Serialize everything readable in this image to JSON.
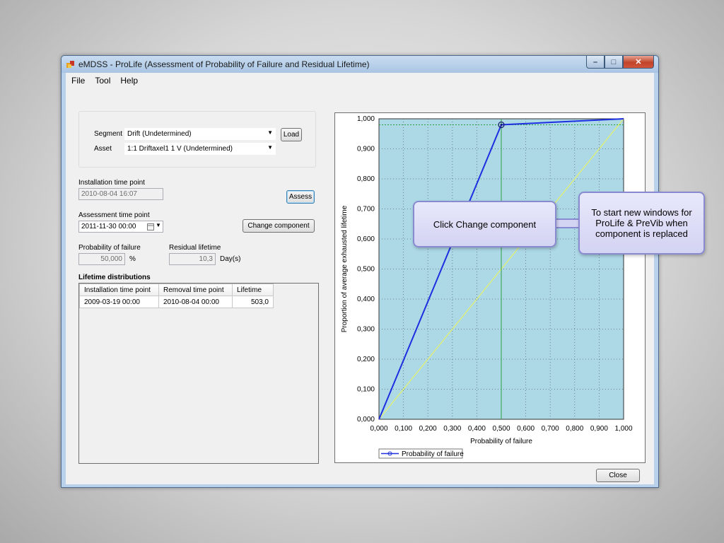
{
  "window": {
    "title": "eMDSS - ProLife (Assessment of Probability of Failure and Residual Lifetime)",
    "min_glyph": "–",
    "max_glyph": "□",
    "close_glyph": "✕"
  },
  "menu": [
    "File",
    "Tool",
    "Help"
  ],
  "segment": {
    "label": "Segment",
    "value": "Drift (Undetermined)"
  },
  "asset": {
    "label": "Asset",
    "value": "1:1    Driftaxel1 1 V (Undetermined)"
  },
  "load_label": "Load",
  "installation": {
    "label": "Installation time point",
    "value": "2010-08-04 16:07"
  },
  "assess_label": "Assess",
  "assessment": {
    "label": "Assessment time point",
    "value": "2011-11-30 00:00"
  },
  "change_component_label": "Change component",
  "probability": {
    "label": "Probability of failure",
    "value": "50,000",
    "unit": "%"
  },
  "residual": {
    "label": "Residual lifetime",
    "value": "10,3",
    "unit": "Day(s)"
  },
  "lifetime_distributions": {
    "title": "Lifetime distributions",
    "columns": [
      "Installation time point",
      "Removal time point",
      "Lifetime"
    ],
    "rows": [
      [
        "2009-03-19 00:00",
        "2010-08-04 00:00",
        "503,0"
      ]
    ]
  },
  "close_label": "Close",
  "callouts": {
    "left": "Click Change component",
    "right": "To start new windows for ProLife & PreVib when component is replaced"
  },
  "colors": {
    "plot_background": "#add8e6",
    "series": "#1d2fe0",
    "diagonal": "#e5f26a",
    "reference": "#2ea043"
  },
  "chart_data": {
    "type": "line",
    "xlabel": "Probability of failure",
    "ylabel": "Proportion of average exhausted lifetime",
    "xlim": [
      0,
      1
    ],
    "ylim": [
      0,
      1
    ],
    "x_ticks": [
      "0,000",
      "0,100",
      "0,200",
      "0,300",
      "0,400",
      "0,500",
      "0,600",
      "0,700",
      "0,800",
      "0,900",
      "1,000"
    ],
    "y_ticks": [
      "0,000",
      "0,100",
      "0,200",
      "0,300",
      "0,400",
      "0,500",
      "0,600",
      "0,700",
      "0,800",
      "0,900",
      "1,000"
    ],
    "grid": true,
    "legend": "bottom-left",
    "series": [
      {
        "name": "Probability of failure",
        "x": [
          0.0,
          0.5,
          1.0
        ],
        "y": [
          0.0,
          0.98,
          1.0
        ]
      }
    ],
    "diagonal": {
      "x": [
        0,
        1
      ],
      "y": [
        0,
        1
      ]
    },
    "reference_point": {
      "x": 0.5,
      "y": 0.98
    }
  }
}
